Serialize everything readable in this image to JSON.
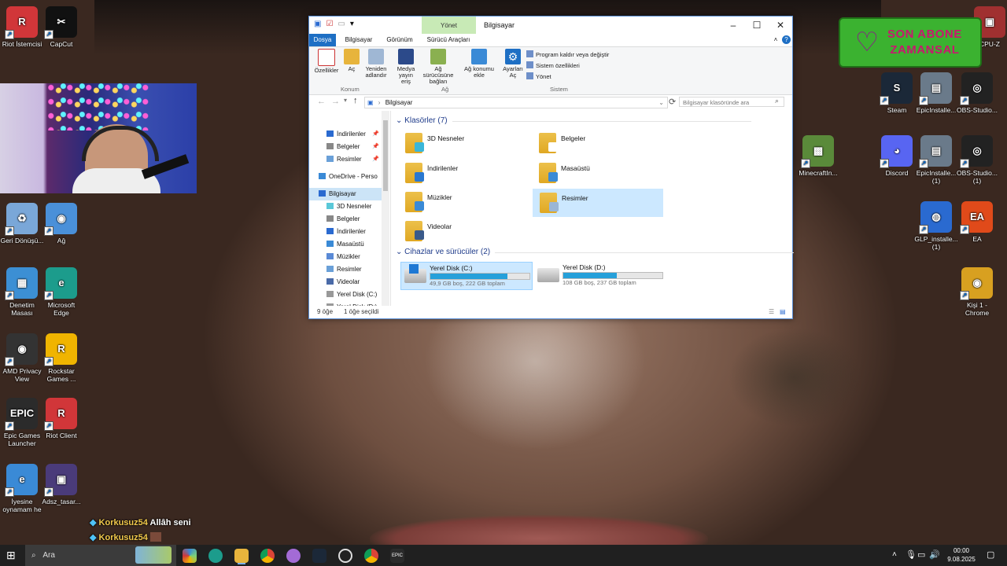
{
  "desktop_icons_left": [
    {
      "label": "Riot İstemcisi",
      "color": "#d13639",
      "glyph": "R"
    },
    {
      "label": "CapCut",
      "color": "#111111",
      "glyph": "✂"
    },
    {
      "label": "Geri Dönüşü...",
      "color": "#7aa7d8",
      "glyph": "♻"
    },
    {
      "label": "Ağ",
      "color": "#4a90d9",
      "glyph": "◉"
    },
    {
      "label": "Denetim Masası",
      "color": "#3c8fd4",
      "glyph": "▦"
    },
    {
      "label": "Microsoft Edge",
      "color": "#1c9c8c",
      "glyph": "e"
    },
    {
      "label": "AMD Privacy View",
      "color": "#333333",
      "glyph": "◉"
    },
    {
      "label": "Rockstar Games ...",
      "color": "#f0b400",
      "glyph": "R"
    },
    {
      "label": "Epic Games Launcher",
      "color": "#2b2b2b",
      "glyph": "EPIC"
    },
    {
      "label": "Riot Client",
      "color": "#d13639",
      "glyph": "R"
    },
    {
      "label": "İyesine oynamam he",
      "color": "#3a8ad6",
      "glyph": "e"
    },
    {
      "label": "Adsz_tasar...",
      "color": "#4a3b7a",
      "glyph": "▣"
    }
  ],
  "desktop_icons_right": [
    {
      "label": "Steam",
      "color": "#1b2838",
      "glyph": "S"
    },
    {
      "label": "EpicInstalle...",
      "color": "#6a7a8a",
      "glyph": "▤"
    },
    {
      "label": "OBS-Studio...",
      "color": "#222222",
      "glyph": "◎"
    },
    {
      "label": "MinecraftIn...",
      "color": "#5a8a3a",
      "glyph": "▩"
    },
    {
      "label": "Discord",
      "color": "#5865f2",
      "glyph": "◕"
    },
    {
      "label": "EpicInstalle... (1)",
      "color": "#6a7a8a",
      "glyph": "▤"
    },
    {
      "label": "OBS-Studio... (1)",
      "color": "#222222",
      "glyph": "◎"
    },
    {
      "label": "GLP_installe... (1)",
      "color": "#2a6ad0",
      "glyph": "◍"
    },
    {
      "label": "EA",
      "color": "#e04a1a",
      "glyph": "EA"
    },
    {
      "label": "Kişi 1 - Chrome",
      "color": "#d8a020",
      "glyph": "◉"
    },
    {
      "label": "CPU-Z",
      "color": "#a03030",
      "glyph": "▣"
    }
  ],
  "overlay": {
    "line1": "SON ABONE",
    "line2": "ZAMANSAL"
  },
  "chat": [
    {
      "user": "Korkusuz54",
      "message": "Allâh seni"
    },
    {
      "user": "Korkusuz54",
      "message": ""
    }
  ],
  "explorer": {
    "title": "Bilgisayar",
    "context_tab": "Yönet",
    "tabs": [
      "Dosya",
      "Bilgisayar",
      "Görünüm",
      "Sürücü Araçları"
    ],
    "ribbon": {
      "buttons": [
        "Özellikler",
        "Aç",
        "Yeniden adlandır",
        "Medya yayın eriş",
        "Ağ sürücüsüne bağlan",
        "Ağ konumu ekle",
        "Ayarları Aç"
      ],
      "system_items": [
        "Program kaldır veya değiştir",
        "Sistem özellikleri",
        "Yönet"
      ],
      "groups": [
        "Konum",
        "Ağ",
        "Sistem"
      ]
    },
    "address": "Bilgisayar",
    "search_placeholder": "Bilgisayar klasöründe ara",
    "nav": [
      "İndirilenler",
      "Belgeler",
      "Resimler",
      "OneDrive - Perso",
      "Bilgisayar",
      "3D Nesneler",
      "Belgeler",
      "İndirilenler",
      "Masaüstü",
      "Müzikler",
      "Resimler",
      "Videolar",
      "Yerel Disk (C:)",
      "Yerel Disk (D:)"
    ],
    "sections": {
      "folders": "Klasörler (7)",
      "drives": "Cihazlar ve sürücüler (2)"
    },
    "folders": [
      "3D Nesneler",
      "Belgeler",
      "İndirilenler",
      "Masaüstü",
      "Müzikler",
      "Resimler",
      "Videolar"
    ],
    "drives": [
      {
        "name": "Yerel Disk (C:)",
        "space": "49,9 GB boş, 222 GB toplam",
        "used_fraction": 0.78
      },
      {
        "name": "Yerel Disk (D:)",
        "space": "108 GB boş, 237 GB toplam",
        "used_fraction": 0.54
      }
    ],
    "status": {
      "items": "9 öğe",
      "selected": "1 öğe seçildi"
    }
  },
  "taskbar": {
    "search_placeholder": "Ara",
    "time": "00:00",
    "date": "9.08.2025"
  }
}
